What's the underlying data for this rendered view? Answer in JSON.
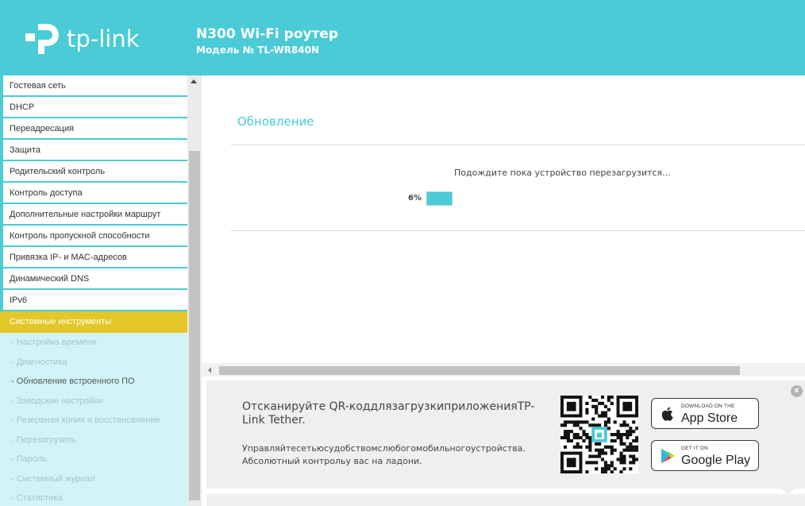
{
  "header": {
    "logo_text": "tp-link",
    "title": "N300 Wi-Fi роутер",
    "model": "Модель № TL-WR840N"
  },
  "sidebar": {
    "items": [
      {
        "label": "Гостевая сеть"
      },
      {
        "label": "DHCP"
      },
      {
        "label": "Переадресация"
      },
      {
        "label": "Защита"
      },
      {
        "label": "Родительский контроль"
      },
      {
        "label": "Контроль доступа"
      },
      {
        "label": "Дополнительные настройки маршрут"
      },
      {
        "label": "Контроль пропускной способности"
      },
      {
        "label": "Привязка IP- и MAC-адресов"
      },
      {
        "label": "Динамический DNS"
      },
      {
        "label": "IPv6"
      },
      {
        "label": "Системные инструменты"
      }
    ],
    "subitems": [
      {
        "label": "- Настройка времени"
      },
      {
        "label": "- Диагностика"
      },
      {
        "label": "- Обновление встроенного ПО"
      },
      {
        "label": "- Заводские настройки"
      },
      {
        "label": "- Резервная копия и восстановление"
      },
      {
        "label": "- Перезагрузить"
      },
      {
        "label": "- Пароль"
      },
      {
        "label": "- Системный журнал"
      },
      {
        "label": "- Статистика"
      }
    ]
  },
  "main": {
    "section_title": "Обновление",
    "message": "Подождите пока устройство перезагрузится...",
    "progress_label": "6%",
    "progress_percent": 6
  },
  "promo": {
    "heading": "Отсканируйте QR-коддлязагрузкиприложенияTP-Link Tether.",
    "text_line1": "Управляйтесетьюсудобствомслюбогомобильногоустройства.",
    "text_line2": "Абсолютный контрольу вас на ладони.",
    "appstore_small": "DOWNLOAD ON THE",
    "appstore_big": "App Store",
    "gplay_small": "GET IT ON",
    "gplay_big": "Google Play",
    "close_glyph": "×"
  },
  "colors": {
    "brand": "#4acbd6",
    "active_menu": "#e3c728",
    "submenu_bg": "#d3f4f7"
  }
}
